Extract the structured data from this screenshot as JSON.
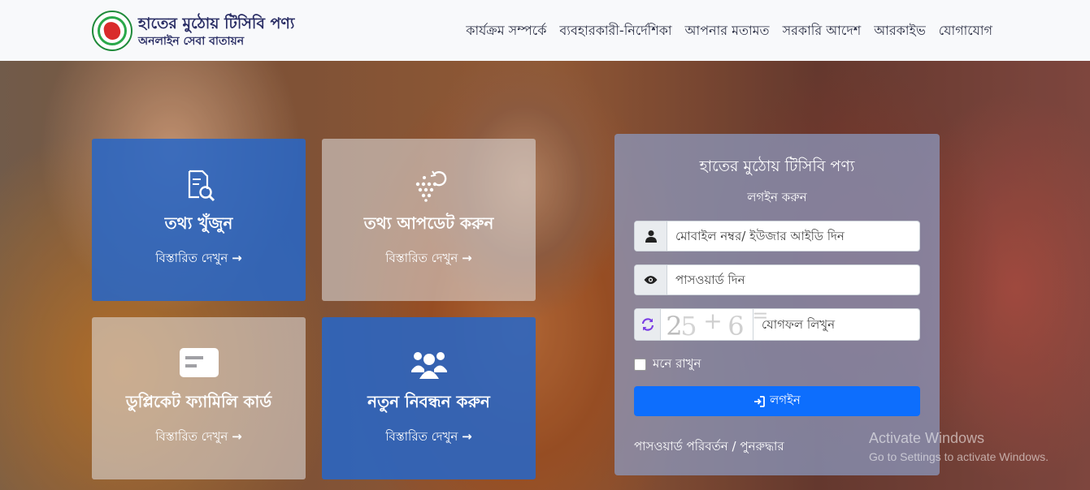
{
  "header": {
    "brand_title": "হাতের মুঠোয় টিসিবি পণ্য",
    "brand_subtitle": "অনলাইন সেবা বাতায়ন",
    "nav": [
      "কার্যক্রম সম্পর্কে",
      "ব্যবহারকারী-নির্দেশিকা",
      "আপনার মতামত",
      "সরকারি আদেশ",
      "আরকাইভ",
      "যোগাযোগ"
    ]
  },
  "tiles": [
    {
      "title": "তথ্য খুঁজুন",
      "link": "বিস্তারিত দেখুন",
      "icon": "search-document-icon"
    },
    {
      "title": "তথ্য আপডেট করুন",
      "link": "বিস্তারিত দেখুন",
      "icon": "update-dots-icon"
    },
    {
      "title": "ডুপ্লিকেট ফ্যামিলি কার্ড",
      "link": "বিস্তারিত দেখুন",
      "icon": "card-icon"
    },
    {
      "title": "নতুন নিবন্ধন করুন",
      "link": "বিস্তারিত দেখুন",
      "icon": "users-icon"
    }
  ],
  "tile_arrow": "→",
  "login": {
    "title": "হাতের মুঠোয় টিসিবি পণ্য",
    "subtitle": "লগইন করুন",
    "user_placeholder": "মোবাইল নম্বর/ ইউজার আইডি দিন",
    "password_placeholder": "পাসওয়ার্ড দিন",
    "captcha_placeholder": "যোগফল লিখুন",
    "captcha_chars": [
      "2",
      "5",
      "+",
      "6",
      "="
    ],
    "remember_label": "মনে রাখুন",
    "login_button": "লগইন",
    "password_link": "পাসওয়ার্ড পরিবর্তন / পুনরুদ্ধার"
  },
  "watermark": {
    "line1": "Activate Windows",
    "line2": "Go to Settings to activate Windows."
  },
  "colors": {
    "brand_text": "#2b2f66",
    "tile_blue": "#2666c8",
    "button_blue": "#0d6efd"
  }
}
